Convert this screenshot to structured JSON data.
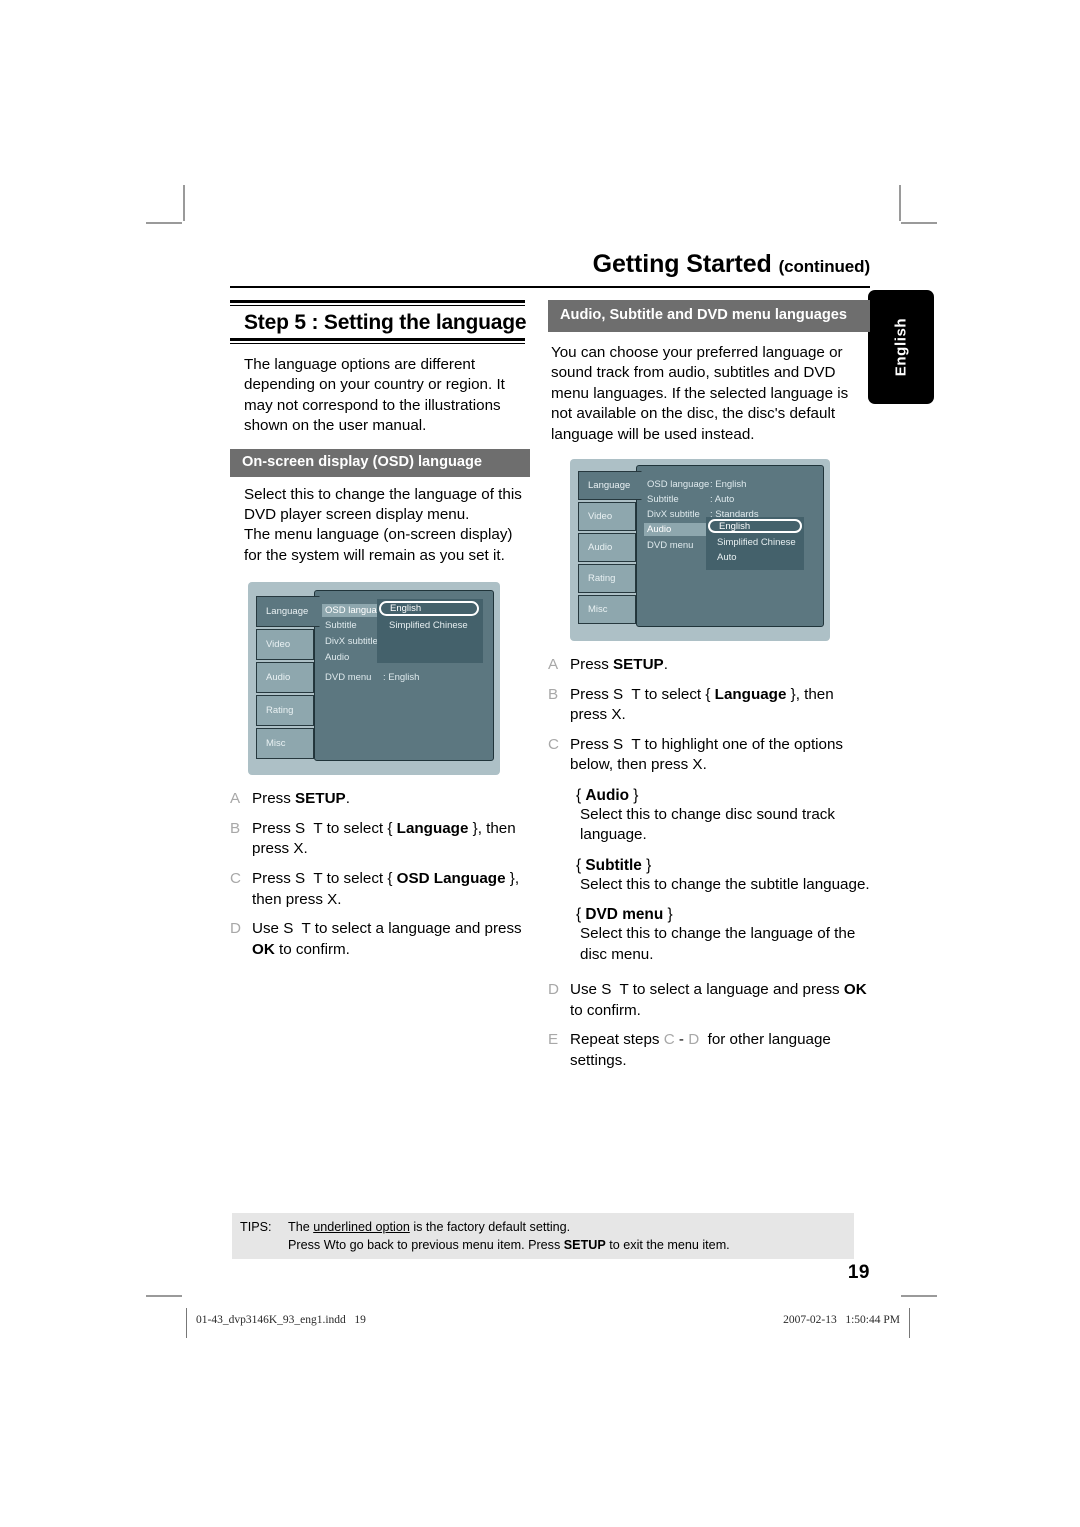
{
  "running_head": {
    "title": "Getting Started ",
    "continued": "(continued)"
  },
  "language_tab": {
    "label": "English"
  },
  "left_column": {
    "step_title": "Step 5 : Setting the language",
    "intro": "The language options are different depending on your country or region. It may not correspond to the illustrations shown on the user manual.",
    "section_header": "On-screen display (OSD) language",
    "body": "Select this to change the language of this DVD player screen display menu.\nThe menu language (on-screen display) for the system will remain as you set it.",
    "body_line1": "Select this to change the language of this DVD player screen display menu.",
    "body_line2": "The menu language (on-screen display) for the system will remain as you set it.",
    "steps": [
      {
        "letter": "A",
        "text": "Press SETUP."
      },
      {
        "letter": "B",
        "text": "Press S T to select { Language }, then press X."
      },
      {
        "letter": "C",
        "text": "Press S T to select { OSD Language }, then press X."
      },
      {
        "letter": "D",
        "text": "Use S T to select a language and press OK to confirm."
      }
    ]
  },
  "right_column": {
    "section_header": "Audio, Subtitle and DVD menu languages",
    "intro": "You can choose your preferred language or sound track from audio, subtitles and DVD menu languages. If the selected language is not available on the disc, the disc's default language will be used instead.",
    "steps_top": [
      {
        "letter": "A",
        "text": "Press SETUP."
      },
      {
        "letter": "B",
        "text": "Press S T to select { Language }, then press X."
      },
      {
        "letter": "C",
        "text": "Press S T to highlight one of the options below, then press X."
      }
    ],
    "options": [
      {
        "title": "Audio",
        "desc": "Select this to change disc sound track language."
      },
      {
        "title": "Subtitle",
        "desc": "Select this to change the subtitle language."
      },
      {
        "title": "DVD menu",
        "desc": "Select this to change the language of the disc menu."
      }
    ],
    "steps_bottom": [
      {
        "letter": "D",
        "text": "Use S T to select a language and press OK to confirm."
      },
      {
        "letter": "E",
        "text": "Repeat steps C - D for other language settings."
      }
    ]
  },
  "osd_left": {
    "tabs": [
      "Language",
      "Video",
      "Audio",
      "Rating",
      "Misc"
    ],
    "active_tab": "Language",
    "menu_items": [
      "OSD language",
      "Subtitle",
      "DivX subtitle",
      "Audio",
      "DVD menu"
    ],
    "selected_item": "OSD language",
    "dvd_menu_value": ": English",
    "popup_options": [
      "English",
      "Simplified Chinese"
    ],
    "highlighted_option": "English"
  },
  "osd_right": {
    "tabs": [
      "Language",
      "Video",
      "Audio",
      "Rating",
      "Misc"
    ],
    "active_tab": "Language",
    "menu_items": [
      "OSD language",
      "Subtitle",
      "DivX subtitle",
      "Audio",
      "DVD menu"
    ],
    "selected_item": "Audio",
    "values": [
      ": English",
      ": Auto",
      ": Standards"
    ],
    "popup_options": [
      "English",
      "Simplified Chinese",
      "Auto"
    ],
    "highlighted_option": "English"
  },
  "tips": {
    "label": "TIPS:",
    "line1_before": "The ",
    "line1_underlined": "underlined option",
    "line1_after": " is the factory default setting.",
    "line2_a": "Press  W",
    "line2_b": "to go back to previous menu item. Press ",
    "line2_bold": "SETUP",
    "line2_c": " to exit the menu item."
  },
  "page_number": "19",
  "colophon": {
    "file": "01-43_dvp3146K_93_eng1.indd   19",
    "timestamp": "2007-02-13   1:50:44 PM"
  }
}
